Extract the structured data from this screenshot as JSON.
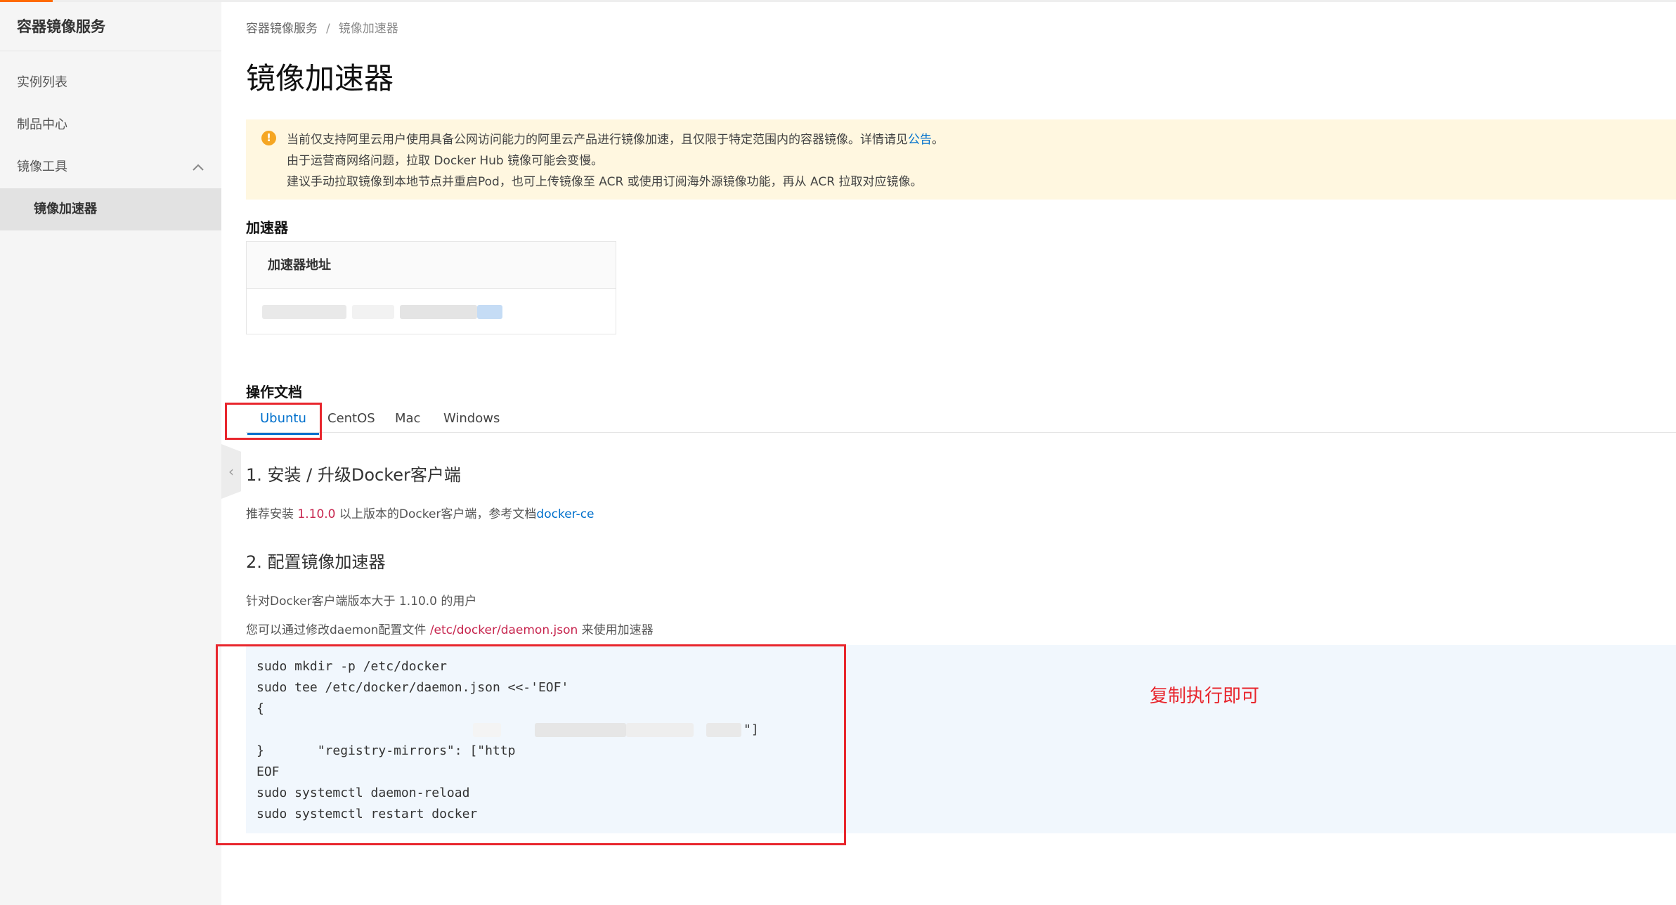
{
  "colors": {
    "accent_orange": "#ff6a00",
    "link_blue": "#0070cc",
    "highlight_red": "#e8262d",
    "code_red": "#c7254e",
    "notice_bg": "#fff7e0"
  },
  "sidebar": {
    "title": "容器镜像服务",
    "items": [
      {
        "label": "实例列表"
      },
      {
        "label": "制品中心"
      },
      {
        "label": "镜像工具",
        "icon": "chevron-up-icon"
      }
    ],
    "subitem": "镜像加速器",
    "collapse_icon": "chevron-left-icon"
  },
  "breadcrumb": {
    "root": "容器镜像服务",
    "separator": "/",
    "current": "镜像加速器"
  },
  "page_title": "镜像加速器",
  "notice": {
    "icon": "warning-icon",
    "line1": "当前仅支持阿里云用户使用具备公网访问能力的阿里云产品进行镜像加速，且仅限于特定范围内的容器镜像。详情请见",
    "line1_link": "公告",
    "line1_end": "。",
    "line2": "由于运营商网络问题，拉取 Docker Hub 镜像可能会变慢。",
    "line3": "建议手动拉取镜像到本地节点并重启Pod，也可上传镜像至 ACR 或使用订阅海外源镜像功能，再从 ACR 拉取对应镜像。"
  },
  "accelerator": {
    "section_label": "加速器",
    "column_header": "加速器地址"
  },
  "docs": {
    "section_label": "操作文档",
    "tabs": [
      {
        "label": "Ubuntu",
        "active": true
      },
      {
        "label": "CentOS",
        "active": false
      },
      {
        "label": "Mac",
        "active": false
      },
      {
        "label": "Windows",
        "active": false
      }
    ],
    "step1": {
      "title": "1. 安装 / 升级Docker客户端",
      "text_before": "推荐安装 ",
      "version": "1.10.0",
      "text_after": " 以上版本的Docker客户端，参考文档",
      "link": "docker-ce"
    },
    "step2": {
      "title": "2. 配置镜像加速器",
      "line1": "针对Docker客户端版本大于 1.10.0 的用户",
      "line2_before": "您可以通过修改daemon配置文件 ",
      "line2_path": "/etc/docker/daemon.json",
      "line2_after": " 来使用加速器"
    },
    "code_lines": [
      "sudo mkdir -p /etc/docker",
      "sudo tee /etc/docker/daemon.json <<-'EOF'",
      "{",
      "  \"registry-mirrors\": [\"http",
      "}",
      "EOF",
      "sudo systemctl daemon-reload",
      "sudo systemctl restart docker"
    ],
    "code_line4_end": "\"]"
  },
  "annotation": "复制执行即可"
}
